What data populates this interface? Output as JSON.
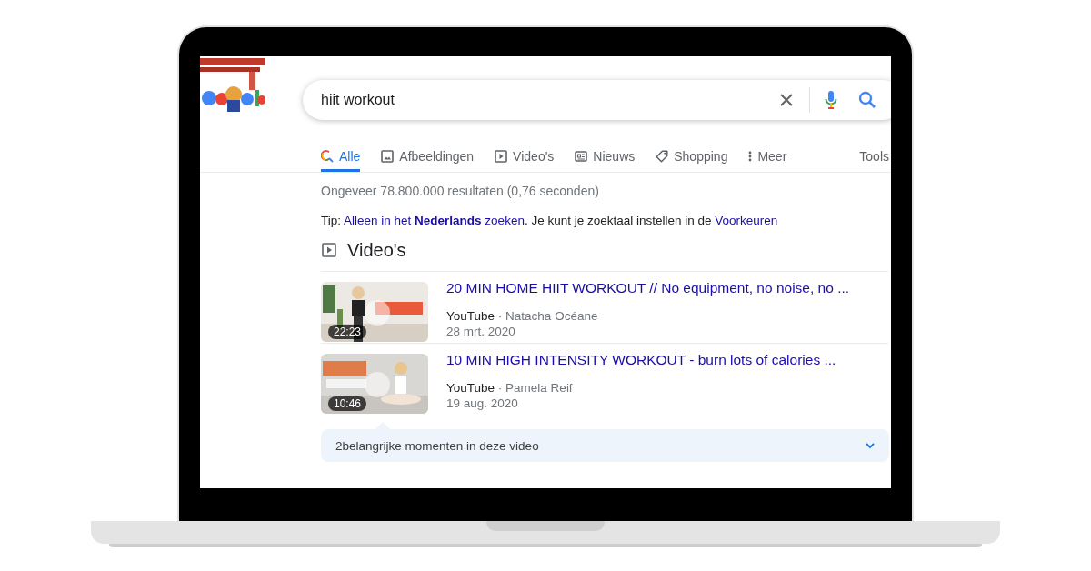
{
  "search": {
    "query": "hiit workout"
  },
  "tabs": [
    {
      "label": "Alle",
      "selected": true
    },
    {
      "label": "Afbeeldingen",
      "selected": false
    },
    {
      "label": "Video's",
      "selected": false
    },
    {
      "label": "Nieuws",
      "selected": false
    },
    {
      "label": "Shopping",
      "selected": false
    },
    {
      "label": "Meer",
      "selected": false
    }
  ],
  "tools": "Tools",
  "result_stats": "Ongeveer 78.800.000 resultaten (0,76 seconden)",
  "tip": [
    {
      "kind": "text",
      "text": "Tip: "
    },
    {
      "kind": "link",
      "text": "Alleen in het **Nederlands** zoeken"
    },
    {
      "kind": "text",
      "text": ". Je kunt je zoektaal instellen in de "
    },
    {
      "kind": "link",
      "text": "Voorkeuren"
    }
  ],
  "videos_heading": "Video's",
  "videos": [
    {
      "title": "20 MIN HOME HIIT WORKOUT // No equipment, no noise, no ...",
      "source": "YouTube",
      "separator": "·",
      "channel": "Natacha Océane",
      "date": "28 mrt. 2020",
      "duration": "22:23"
    },
    {
      "title": "10 MIN HIGH INTENSITY WORKOUT - burn lots of calories ...",
      "source": "YouTube",
      "separator": "·",
      "channel": "Pamela Reif",
      "date": "19 aug. 2020",
      "duration": "10:46",
      "key_moments": "2belangrijke momenten in deze video"
    }
  ]
}
